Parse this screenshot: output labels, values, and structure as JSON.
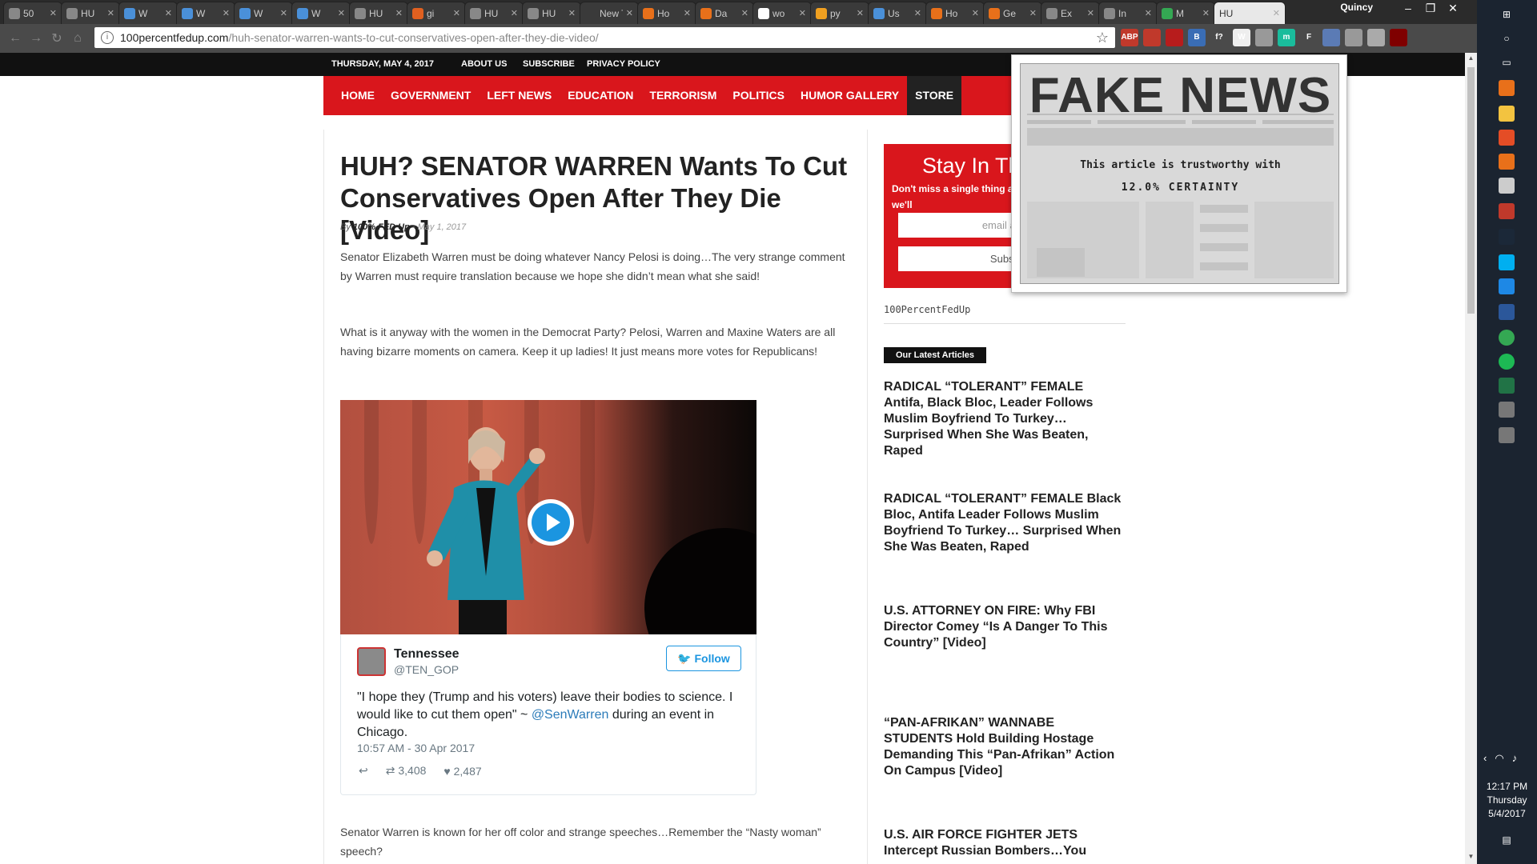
{
  "browser": {
    "tabs": [
      {
        "label": "50",
        "color": "#888888"
      },
      {
        "label": "HU",
        "color": "#888888"
      },
      {
        "label": "W",
        "color": "#4a90d9"
      },
      {
        "label": "W",
        "color": "#4a90d9"
      },
      {
        "label": "W",
        "color": "#4a90d9"
      },
      {
        "label": "W",
        "color": "#4a90d9"
      },
      {
        "label": "HU",
        "color": "#888888"
      },
      {
        "label": "gi",
        "color": "#e06020"
      },
      {
        "label": "HU",
        "color": "#888888"
      },
      {
        "label": "HU",
        "color": "#888888"
      },
      {
        "label": "New T",
        "color": "#3a3a3a"
      },
      {
        "label": "Ho",
        "color": "#e8701a"
      },
      {
        "label": "Da",
        "color": "#e8701a"
      },
      {
        "label": "wo",
        "color": "#ffffff"
      },
      {
        "label": "py",
        "color": "#f0a020"
      },
      {
        "label": "Us",
        "color": "#4a90d9"
      },
      {
        "label": "Ho",
        "color": "#e8701a"
      },
      {
        "label": "Ge",
        "color": "#e8701a"
      },
      {
        "label": "Ex",
        "color": "#888888"
      },
      {
        "label": "In",
        "color": "#888888"
      },
      {
        "label": "M",
        "color": "#34a853"
      }
    ],
    "active_tab": "HU",
    "profile_name": "Quincy",
    "url_domain": "100percentfedup.com",
    "url_path": "/huh-senator-warren-wants-to-cut-conservatives-open-after-they-die-video/",
    "extensions": [
      {
        "name": "adblock-plus-icon",
        "label": "ABP",
        "color": "#c0392b"
      },
      {
        "name": "ublock-icon",
        "label": "",
        "color": "#c0392b"
      },
      {
        "name": "acrobat-icon",
        "label": "",
        "color": "#b71c1c"
      },
      {
        "name": "b-extension-icon",
        "label": "B",
        "color": "#3a6db5"
      },
      {
        "name": "fx-extension-icon",
        "label": "f?",
        "color": "#4a4a4a"
      },
      {
        "name": "w-extension-icon",
        "label": "W",
        "color": "#eeeeee"
      },
      {
        "name": "chat-extension-icon",
        "label": "",
        "color": "#999999"
      },
      {
        "name": "m-extension-icon",
        "label": "m",
        "color": "#1abc9c"
      },
      {
        "name": "fake-news-extension-icon",
        "label": "F",
        "color": "#4a4a4a"
      },
      {
        "name": "cloud-extension-icon",
        "label": "",
        "color": "#5b7bb5"
      },
      {
        "name": "tool-extension-icon",
        "label": "",
        "color": "#999999"
      },
      {
        "name": "mail-extension-icon",
        "label": "",
        "color": "#aaaaaa"
      },
      {
        "name": "ublock-origin-icon",
        "label": "",
        "color": "#7f0000"
      }
    ]
  },
  "site": {
    "topbar": {
      "date": "THURSDAY, MAY 4, 2017",
      "about": "ABOUT US",
      "subscribe": "SUBSCRIBE",
      "privacy": "PRIVACY POLICY"
    },
    "nav": [
      "HOME",
      "GOVERNMENT",
      "LEFT NEWS",
      "EDUCATION",
      "TERRORISM",
      "POLITICS",
      "HUMOR GALLERY",
      "STORE"
    ],
    "article": {
      "title": "HUH? SENATOR WARREN Wants To Cut Conservatives Open After They Die [Video]",
      "by": "By",
      "author": "100% FED Up",
      "date": "- May 1, 2017",
      "p1": "Senator Elizabeth Warren must be doing whatever Nancy Pelosi is doing…The very strange comment by Warren must require translation because we hope she didn’t mean what she said!",
      "p2": "What is it anyway with the women in the Democrat Party? Pelosi, Warren and Maxine Waters are all having bizarre moments on camera. Keep it up ladies! It just means more votes for Republicans!",
      "p3": "Senator Warren is known for her off color and strange speeches…Remember the “Nasty woman” speech?"
    },
    "tweet": {
      "name": "Tennessee",
      "handle": "@TEN_GOP",
      "follow": "Follow",
      "text_before": "\"I hope they (Trump and his voters) leave their bodies to science. I would like to cut them open\" ~ ",
      "mention": "@SenWarren",
      "text_after": " during an event in Chicago.",
      "time": "10:57 AM - 30 Apr 2017",
      "retweets": "3,408",
      "likes": "2,487"
    },
    "sidebar": {
      "subscribe_heading": "Stay In Th",
      "subscribe_text": "Don't miss a single thing address below and we'll",
      "email_placeholder": "email add",
      "subscribe_button": "Subsc",
      "site_name": "100PercentFedUp",
      "latest_heading": "Our Latest Articles",
      "articles": [
        "RADICAL “TOLERANT” FEMALE Antifa, Black Bloc, Leader Follows Muslim Boyfriend To Turkey… Surprised When She Was Beaten, Raped",
        "RADICAL “TOLERANT” FEMALE Black Bloc, Antifa Leader Follows Muslim Boyfriend To Turkey… Surprised When She Was Beaten, Raped",
        "U.S. ATTORNEY ON FIRE: Why FBI Director Comey “Is A Danger To This Country” [Video]",
        "“PAN-AFRIKAN” WANNABE STUDENTS Hold Building Hostage Demanding This “Pan-Afrikan” Action On Campus [Video]",
        "U.S. AIR FORCE FIGHTER JETS Intercept Russian Bombers…You"
      ]
    }
  },
  "popup": {
    "masthead": "FAKE NEWS",
    "line1": "This article is trustworthy with",
    "line2": "12.0% CERTAINTY",
    "certainty": 0.12
  },
  "taskbar": {
    "time": "12:17 PM",
    "day": "Thursday",
    "date": "5/4/2017",
    "colors": {
      "bg": "#1b2430"
    }
  },
  "colors": {
    "brand_red": "#d9161c",
    "twitter_blue": "#1b95e0"
  }
}
